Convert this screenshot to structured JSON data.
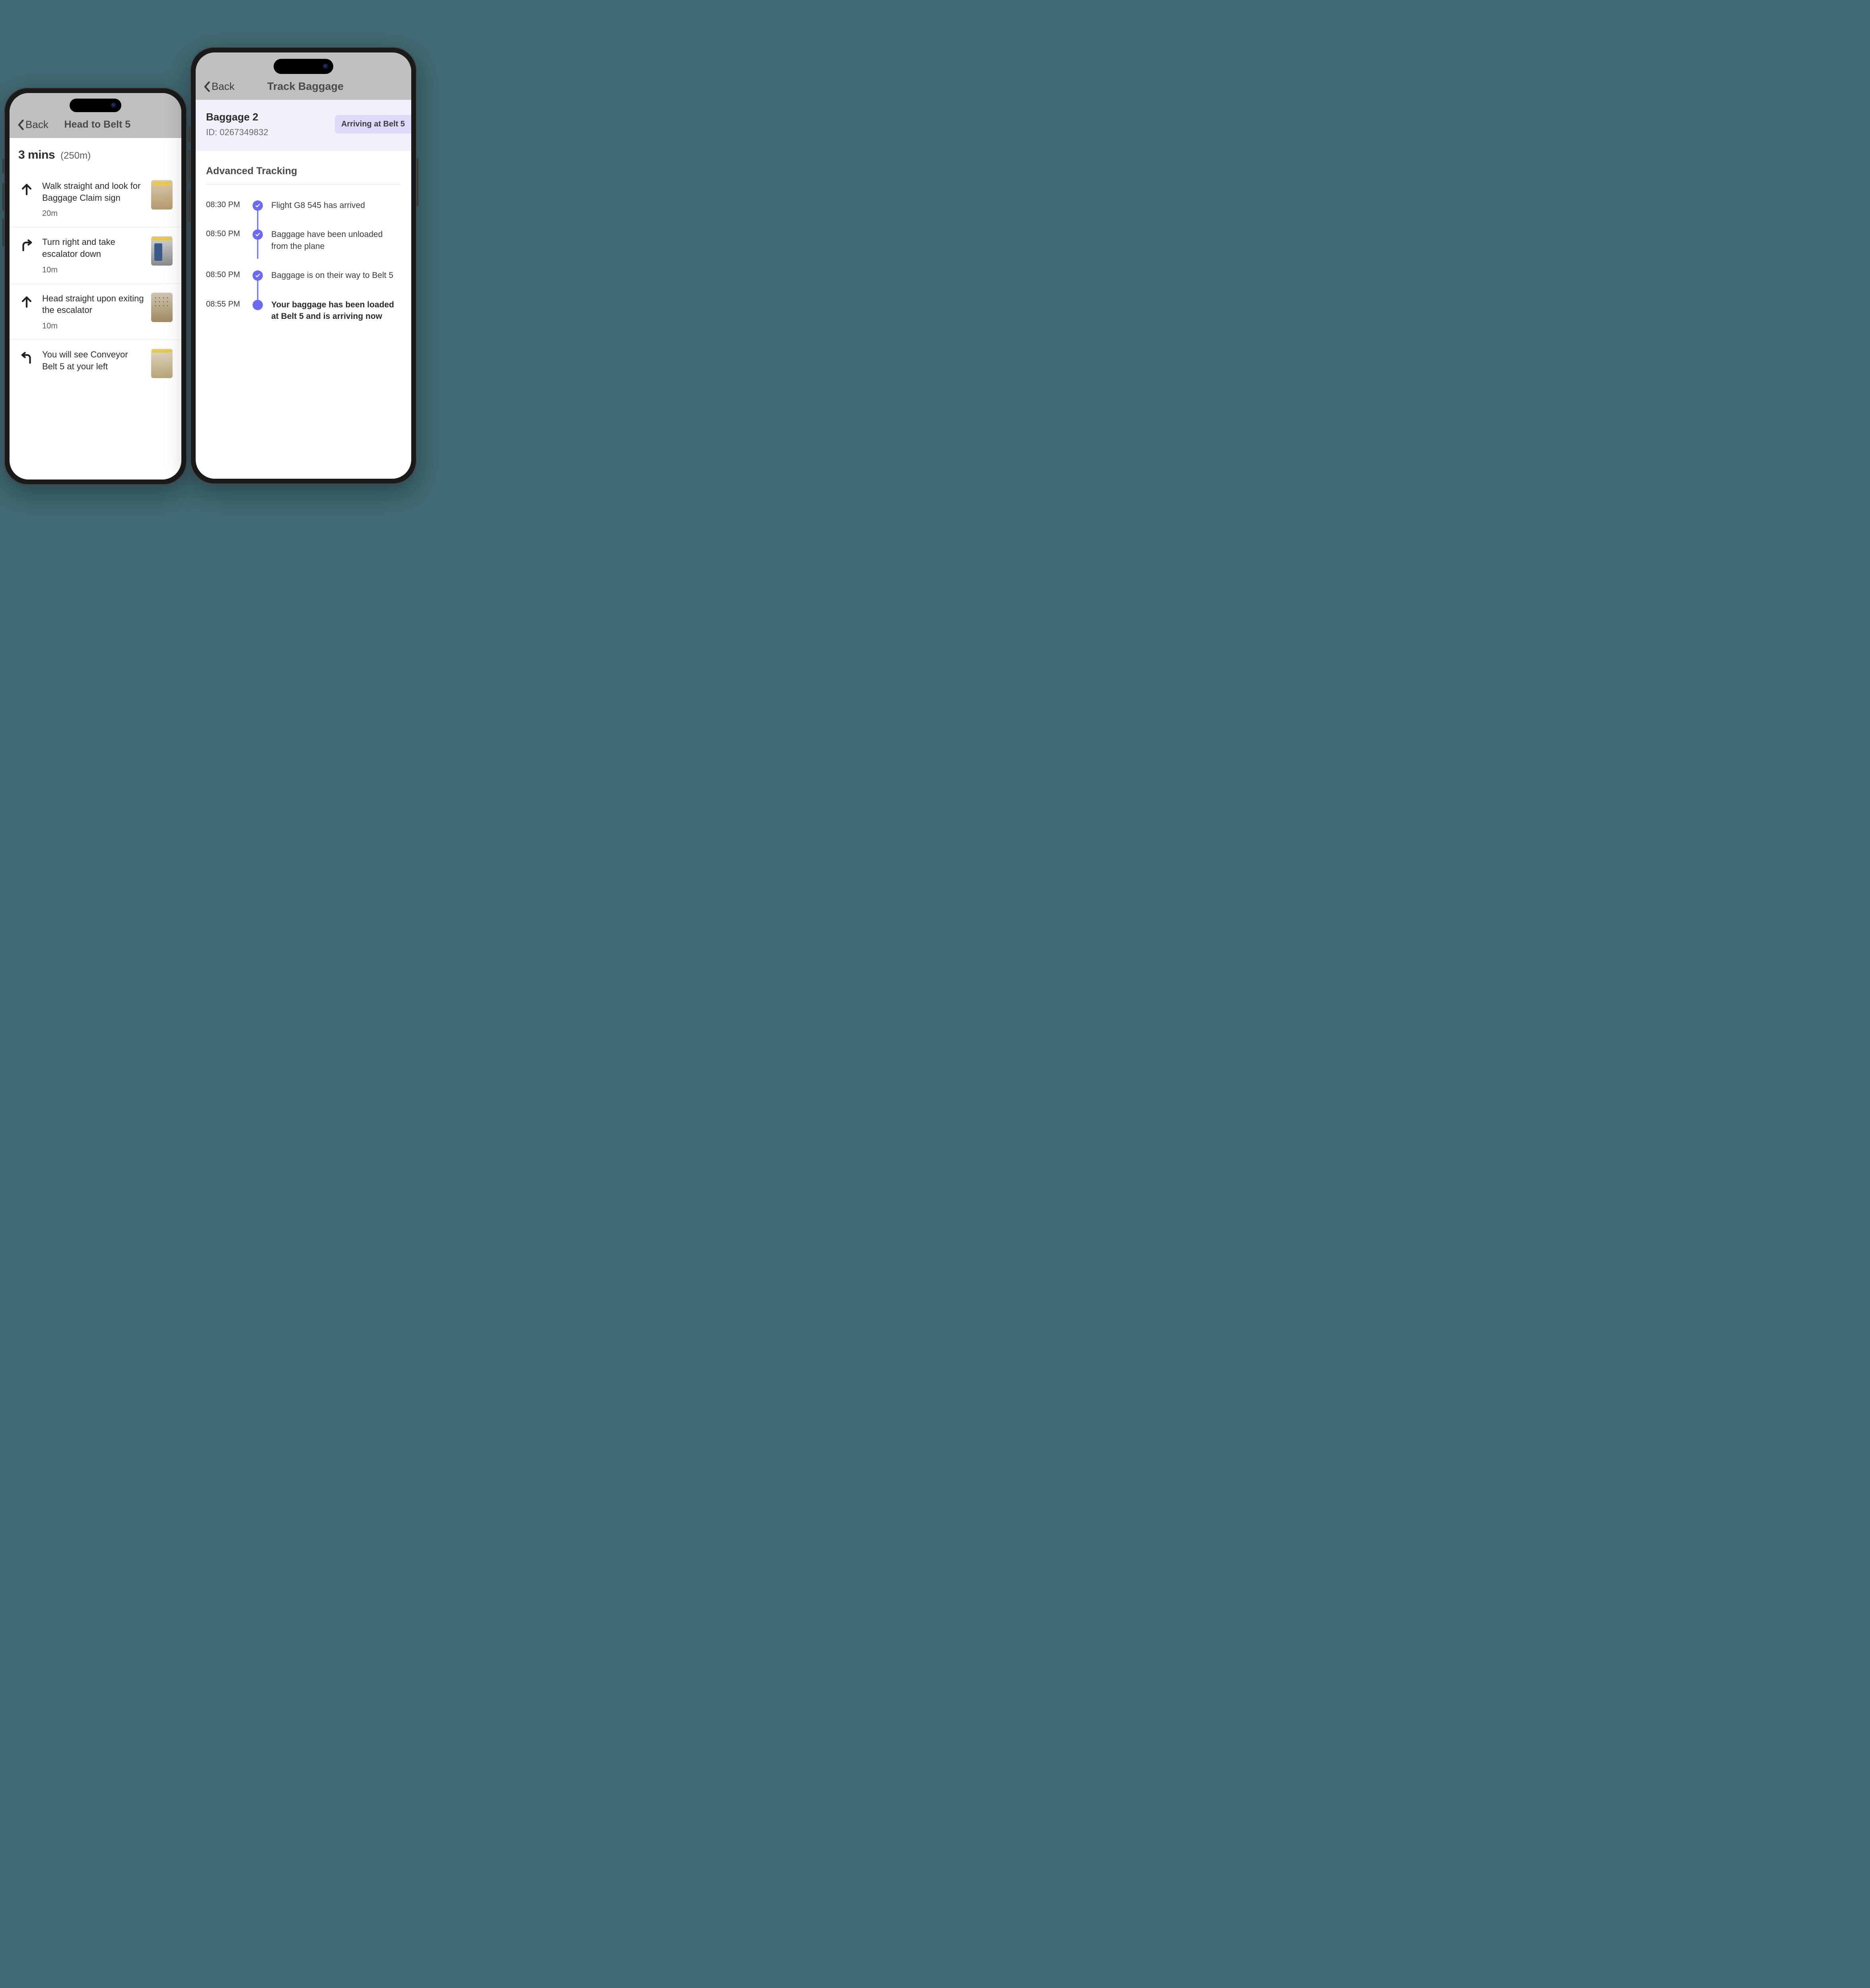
{
  "left": {
    "back_label": "Back",
    "title": "Head to Belt 5",
    "eta_time": "3 mins",
    "eta_distance": "(250m)",
    "steps": [
      {
        "icon": "up",
        "text": "Walk straight and look for Baggage Claim sign",
        "dist": "20m"
      },
      {
        "icon": "turn-right",
        "text": "Turn right and take escalator down",
        "dist": "10m"
      },
      {
        "icon": "up",
        "text": "Head straight upon exiting the escalator",
        "dist": "10m"
      },
      {
        "icon": "turn-left",
        "text": "You will see Conveyor Belt 5 at your left",
        "dist": ""
      }
    ]
  },
  "right": {
    "back_label": "Back",
    "title": "Track Baggage",
    "baggage_name": "Baggage 2",
    "baggage_id_label": "ID: 0267349832",
    "status_badge": "Arriving at Belt 5",
    "section_title": "Advanced Tracking",
    "events": [
      {
        "time": "08:30 PM",
        "text": "Flight G8 545 has arrived",
        "done": true,
        "current": false
      },
      {
        "time": "08:50 PM",
        "text": "Baggage have been unloaded from the plane",
        "done": true,
        "current": false
      },
      {
        "time": "08:50 PM",
        "text": "Baggage is on their way to Belt 5",
        "done": true,
        "current": false
      },
      {
        "time": "08:55 PM",
        "text": "Your baggage has been loaded at Belt 5 and is arriving now",
        "done": false,
        "current": true
      }
    ]
  }
}
